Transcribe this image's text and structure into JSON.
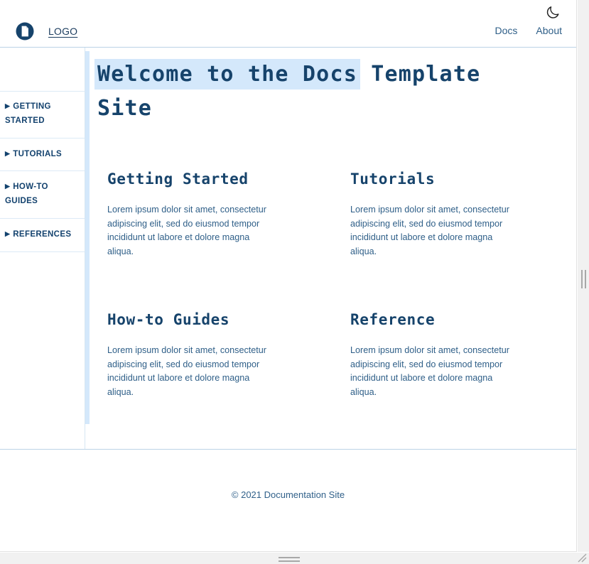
{
  "header": {
    "logo_icon": "document-circle-logo",
    "logo_text": "LOGO",
    "theme_toggle_icon": "moon-icon",
    "nav": [
      {
        "label": "Docs"
      },
      {
        "label": "About"
      }
    ]
  },
  "sidebar": {
    "items": [
      {
        "label": "GETTING STARTED",
        "caret": "▶"
      },
      {
        "label": "TUTORIALS",
        "caret": "▶"
      },
      {
        "label": "HOW-TO GUIDES",
        "caret": "▶"
      },
      {
        "label": "REFERENCES",
        "caret": "▶"
      }
    ]
  },
  "main": {
    "title_highlighted": "Welcome to the Docs",
    "title_rest": " Template Site",
    "cards": [
      {
        "title": "Getting Started",
        "body": "Lorem ipsum dolor sit amet, consectetur adipiscing elit, sed do eiusmod tempor incididunt ut labore et dolore magna aliqua."
      },
      {
        "title": "Tutorials",
        "body": "Lorem ipsum dolor sit amet, consectetur adipiscing elit, sed do eiusmod tempor incididunt ut labore et dolore magna aliqua."
      },
      {
        "title": "How-to Guides",
        "body": "Lorem ipsum dolor sit amet, consectetur adipiscing elit, sed do eiusmod tempor incididunt ut labore et dolore magna aliqua."
      },
      {
        "title": "Reference",
        "body": "Lorem ipsum dolor sit amet, consectetur adipiscing elit, sed do eiusmod tempor incididunt ut labore et dolore magna aliqua."
      }
    ]
  },
  "footer": {
    "copyright": "© 2021 Documentation Site"
  },
  "colors": {
    "navy": "#16436b",
    "link_blue": "#2f5f88",
    "accent_light_blue": "#d4e8fb",
    "rule_blue": "#bcd3e6",
    "chrome_grey": "#f1f1f1"
  }
}
